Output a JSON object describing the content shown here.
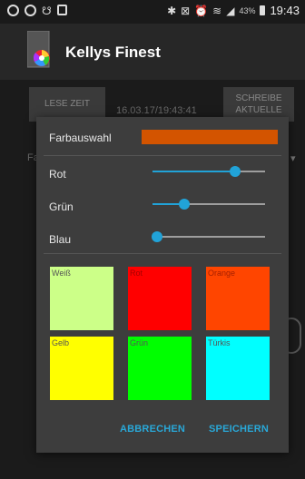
{
  "statusbar": {
    "time": "19:43",
    "battery": "43%"
  },
  "app": {
    "title": "Kellys Finest"
  },
  "background": {
    "read_button": "LESE ZEIT",
    "datetime": "16.03.17/19:43:41",
    "write_button_line1": "SCHREIBE",
    "write_button_line2": "AKTUELLE",
    "side_label": "Fa"
  },
  "dialog": {
    "preview_label": "Farbauswahl",
    "preview_color": "#d35400",
    "sliders": [
      {
        "label": "Rot",
        "value": 0.73
      },
      {
        "label": "Grün",
        "value": 0.28
      },
      {
        "label": "Blau",
        "value": 0.04
      }
    ],
    "swatches": [
      {
        "label": "Weiß",
        "color": "#ccff88"
      },
      {
        "label": "Rot",
        "color": "#ff0000"
      },
      {
        "label": "Orange",
        "color": "#ff4500"
      },
      {
        "label": "Gelb",
        "color": "#ffff00"
      },
      {
        "label": "Grün",
        "color": "#00ff00"
      },
      {
        "label": "Türkis",
        "color": "#00ffff"
      }
    ],
    "cancel_label": "ABBRECHEN",
    "save_label": "SPEICHERN"
  },
  "colors": {
    "accent": "#21a3d8"
  },
  "icons": {
    "app": "color-wheel-icon"
  }
}
